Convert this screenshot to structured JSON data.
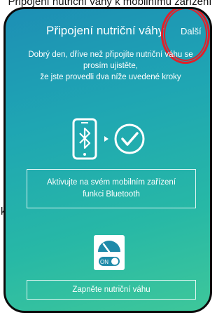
{
  "background": {
    "caption": "Připojení nutriční váhy k mobilnímu zařízení",
    "stray_char": "k"
  },
  "header": {
    "title": "Připojení nutriční váhy",
    "next_label": "Další"
  },
  "intro": {
    "line1": "Dobrý den, dříve než připojíte nutriční váhu se",
    "line2": "prosím ujistěte,",
    "line3": "že jste provedli dva níže uvedené kroky"
  },
  "steps": {
    "bluetooth_line1": "Aktivujte na svém mobilním zařízení",
    "bluetooth_line2": "funkci Bluetooth",
    "scale_label": "Zapněte nutriční váhu",
    "switch_label": "ON"
  },
  "icons": [
    "phone-bluetooth-icon",
    "play-arrow-icon",
    "check-circle-icon",
    "scale-icon"
  ],
  "colors": {
    "gradient_start": "#1d8fb5",
    "gradient_end": "#3ec79a",
    "highlight_ring": "#e0202a"
  }
}
